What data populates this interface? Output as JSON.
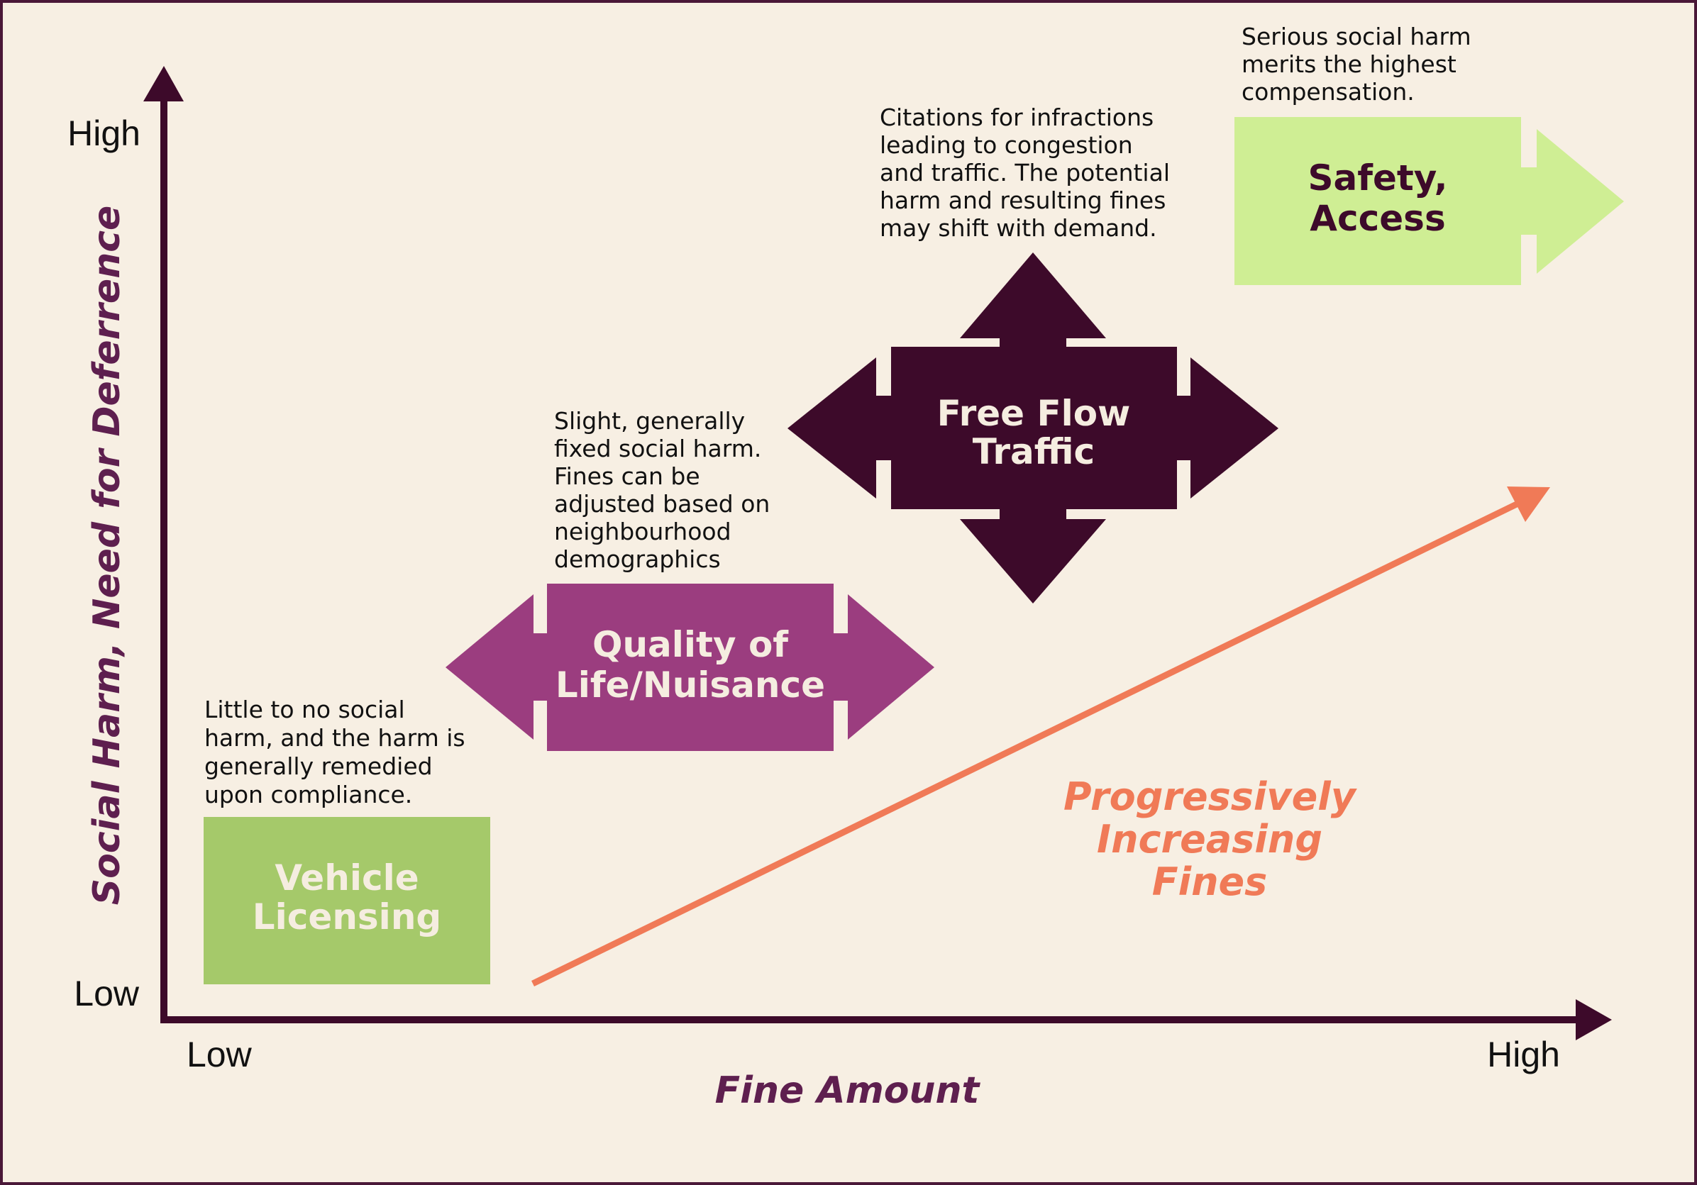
{
  "diagram": {
    "y_axis": {
      "title": "Social Harm, Need for Deferrence",
      "low_label": "Low",
      "high_label": "High"
    },
    "x_axis": {
      "title": "Fine Amount",
      "low_label": "Low",
      "high_label": "High"
    },
    "trend": {
      "lines": [
        "Progressively",
        "Increasing",
        "Fines"
      ]
    },
    "categories": [
      {
        "id": "vehicle-licensing",
        "title_lines": [
          "Vehicle",
          "Licensing"
        ],
        "description_lines": [
          "Little to no social",
          "harm, and the harm is",
          "generally remedied",
          "upon compliance."
        ],
        "shape": "rectangle",
        "fill": "#a5c96a",
        "text_color": "#f5ede0"
      },
      {
        "id": "quality-of-life",
        "title_lines": [
          "Quality of",
          "Life/Nuisance"
        ],
        "description_lines": [
          "Slight, generally",
          "fixed social harm.",
          "Fines can be",
          "adjusted based on",
          "neighbourhood",
          "demographics"
        ],
        "shape": "left-right-arrow",
        "fill": "#9b3d7f",
        "text_color": "#f5ede0"
      },
      {
        "id": "free-flow-traffic",
        "title_lines": [
          "Free Flow",
          "Traffic"
        ],
        "description_lines": [
          "Citations for infractions",
          "leading to congestion",
          "and traffic. The potential",
          "harm and resulting fines",
          "may shift with demand."
        ],
        "shape": "four-way-arrow",
        "fill": "#3d0a2a",
        "text_color": "#f5ede0"
      },
      {
        "id": "safety-access",
        "title_lines": [
          "Safety,",
          "Access"
        ],
        "description_lines": [
          "Serious social harm",
          "merits the highest",
          "compensation."
        ],
        "shape": "right-arrow",
        "fill": "#cfee94",
        "text_color": "#3d0a2a"
      }
    ],
    "colors": {
      "background": "#f7efe3",
      "border": "#4a1838",
      "axis": "#3d0a2a",
      "axis_title": "#5e1f4f",
      "trend": "#f07a57"
    }
  }
}
